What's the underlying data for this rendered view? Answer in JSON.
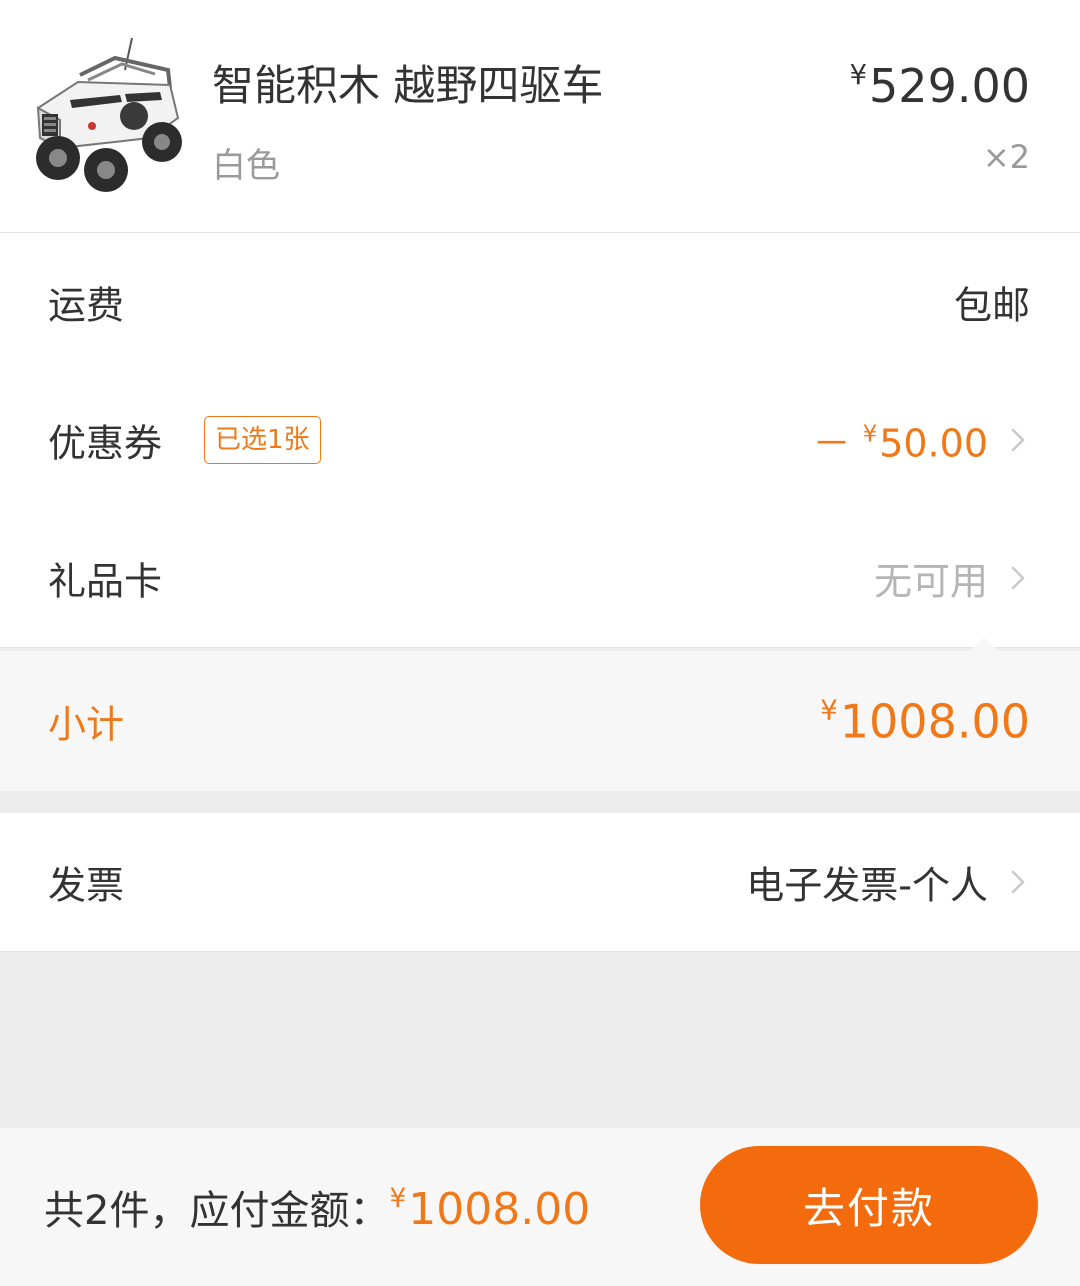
{
  "product": {
    "name": "智能积木 越野四驱车",
    "variant": "白色",
    "currency_symbol": "¥",
    "price": "529.00",
    "quantity": "×2",
    "image_icon": "offroad-4wd-building-block-car-image"
  },
  "rows": {
    "shipping": {
      "label": "运费",
      "value": "包邮"
    },
    "coupon": {
      "label": "优惠券",
      "badge": "已选1张",
      "value_prefix": "－",
      "currency_symbol": "¥",
      "value": "50.00"
    },
    "gift_card": {
      "label": "礼品卡",
      "value": "无可用"
    },
    "invoice": {
      "label": "发票",
      "value": "电子发票-个人"
    }
  },
  "subtotal": {
    "label": "小计",
    "currency_symbol": "¥",
    "value": "1008.00"
  },
  "footer": {
    "summary_prefix": "共2件，应付金额：",
    "currency_symbol": "¥",
    "amount": "1008.00",
    "pay_button_label": "去付款"
  },
  "colors": {
    "accent": "#f07818",
    "pay_button": "#f46b0e",
    "muted_text": "#b5b5b5",
    "background": "#ececec"
  },
  "icons": {
    "row_chevron": "chevron-right-icon"
  }
}
